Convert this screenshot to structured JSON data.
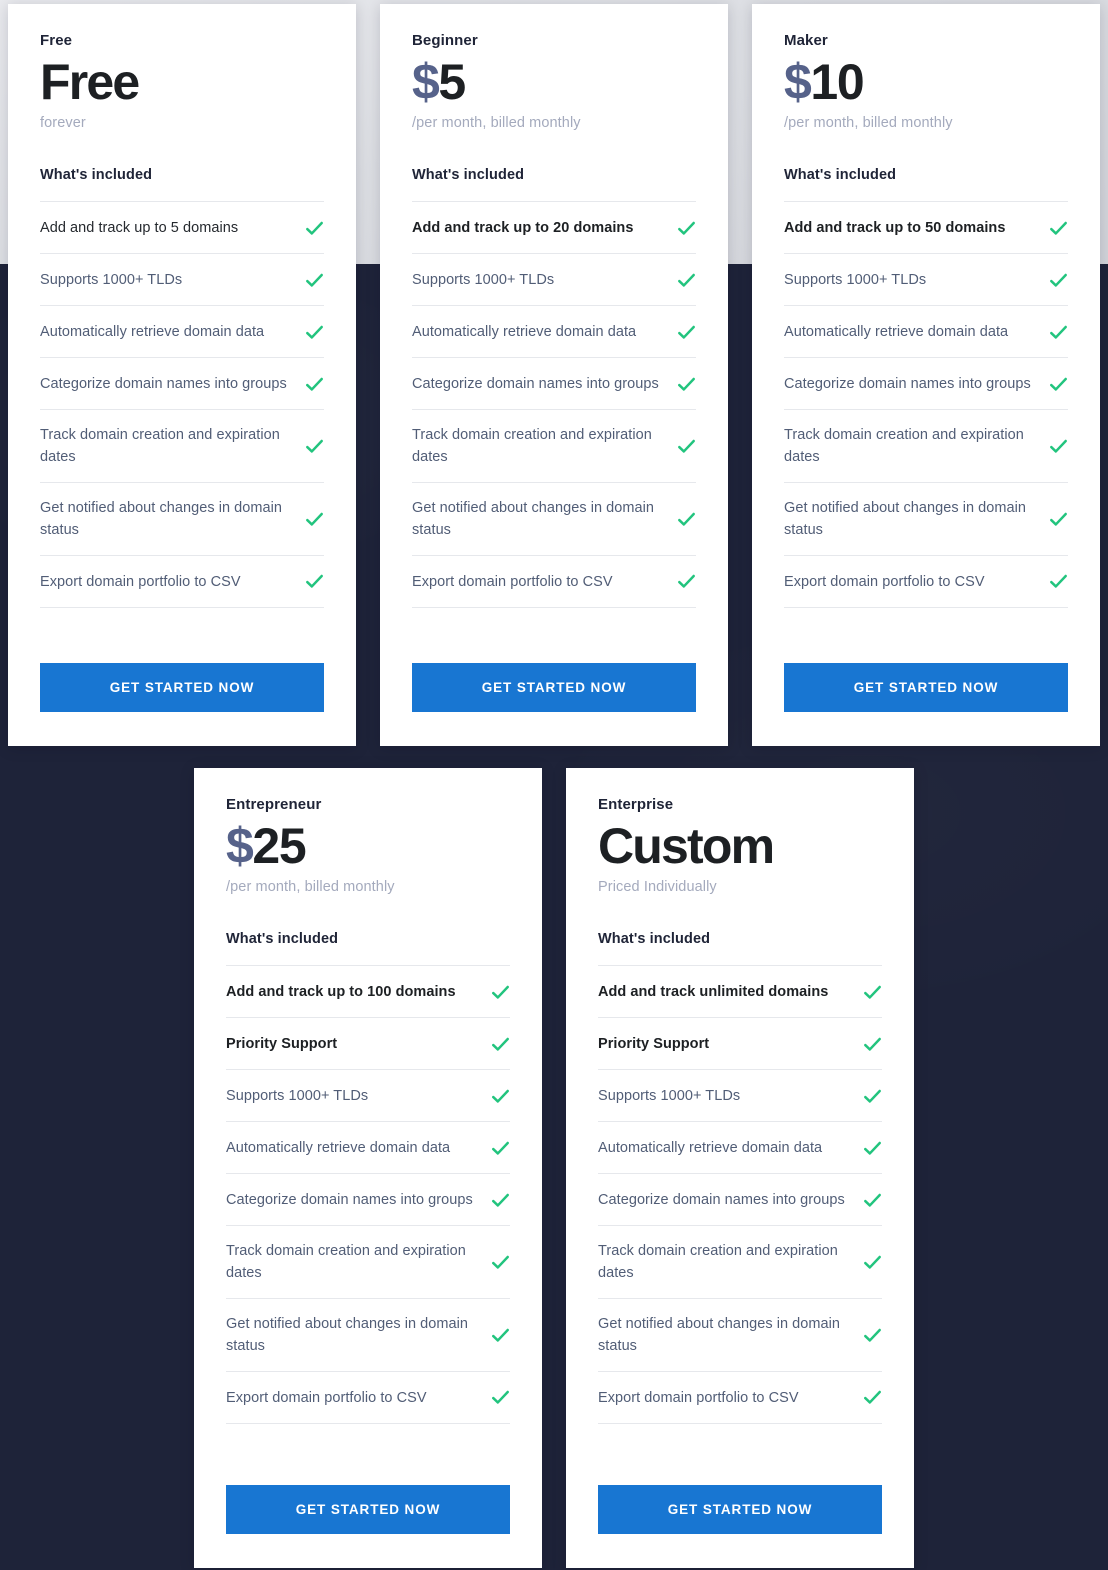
{
  "theme": {
    "page_bg_dark": "#1e2339",
    "page_bg_light": "#e3e5ea",
    "card_bg": "#ffffff",
    "cta_blue": "#1876d2",
    "check_green": "#22c47e",
    "currency_slate": "#56628a",
    "muted_text": "#515d76",
    "note_text": "#a4aabd",
    "heading_text": "#1f2437"
  },
  "labels": {
    "included": "What's included",
    "cta": "GET STARTED NOW"
  },
  "icons": {
    "check": "check-icon"
  },
  "plans": [
    {
      "id": "free",
      "name": "Free",
      "price_currency": "",
      "price_amount": "Free",
      "price_is_word": true,
      "note": "forever",
      "features": [
        {
          "text": "Add and track up to 5 domains",
          "emphasis": "plain",
          "included": true
        },
        {
          "text": "Supports 1000+ TLDs",
          "emphasis": "none",
          "included": true
        },
        {
          "text": "Automatically retrieve domain data",
          "emphasis": "none",
          "included": true
        },
        {
          "text": "Categorize domain names into groups",
          "emphasis": "none",
          "included": true
        },
        {
          "text": "Track domain creation and expiration dates",
          "emphasis": "none",
          "included": true
        },
        {
          "text": "Get notified about changes in domain status",
          "emphasis": "none",
          "included": true
        },
        {
          "text": "Export domain portfolio to CSV",
          "emphasis": "none",
          "included": true
        }
      ]
    },
    {
      "id": "beginner",
      "name": "Beginner",
      "price_currency": "$",
      "price_amount": "5",
      "price_is_word": false,
      "note": "/per month, billed monthly",
      "features": [
        {
          "text": "Add and track up to 20 domains",
          "emphasis": "bold",
          "included": true
        },
        {
          "text": "Supports 1000+ TLDs",
          "emphasis": "none",
          "included": true
        },
        {
          "text": "Automatically retrieve domain data",
          "emphasis": "none",
          "included": true
        },
        {
          "text": "Categorize domain names into groups",
          "emphasis": "none",
          "included": true
        },
        {
          "text": "Track domain creation and expiration dates",
          "emphasis": "none",
          "included": true
        },
        {
          "text": "Get notified about changes in domain status",
          "emphasis": "none",
          "included": true
        },
        {
          "text": "Export domain portfolio to CSV",
          "emphasis": "none",
          "included": true
        }
      ]
    },
    {
      "id": "maker",
      "name": "Maker",
      "price_currency": "$",
      "price_amount": "10",
      "price_is_word": false,
      "note": "/per month, billed monthly",
      "features": [
        {
          "text": "Add and track up to 50 domains",
          "emphasis": "bold",
          "included": true
        },
        {
          "text": "Supports 1000+ TLDs",
          "emphasis": "none",
          "included": true
        },
        {
          "text": "Automatically retrieve domain data",
          "emphasis": "none",
          "included": true
        },
        {
          "text": "Categorize domain names into groups",
          "emphasis": "none",
          "included": true
        },
        {
          "text": "Track domain creation and expiration dates",
          "emphasis": "none",
          "included": true
        },
        {
          "text": "Get notified about changes in domain status",
          "emphasis": "none",
          "included": true
        },
        {
          "text": "Export domain portfolio to CSV",
          "emphasis": "none",
          "included": true
        }
      ]
    },
    {
      "id": "entrepreneur",
      "name": "Entrepreneur",
      "price_currency": "$",
      "price_amount": "25",
      "price_is_word": false,
      "note": "/per month, billed monthly",
      "features": [
        {
          "text": "Add and track up to 100 domains",
          "emphasis": "bold",
          "included": true
        },
        {
          "text": "Priority Support",
          "emphasis": "bold",
          "included": true
        },
        {
          "text": "Supports 1000+ TLDs",
          "emphasis": "none",
          "included": true
        },
        {
          "text": "Automatically retrieve domain data",
          "emphasis": "none",
          "included": true
        },
        {
          "text": "Categorize domain names into groups",
          "emphasis": "none",
          "included": true
        },
        {
          "text": "Track domain creation and expiration dates",
          "emphasis": "none",
          "included": true
        },
        {
          "text": "Get notified about changes in domain status",
          "emphasis": "none",
          "included": true
        },
        {
          "text": "Export domain portfolio to CSV",
          "emphasis": "none",
          "included": true
        }
      ]
    },
    {
      "id": "enterprise",
      "name": "Enterprise",
      "price_currency": "",
      "price_amount": "Custom",
      "price_is_word": true,
      "note": "Priced Individually",
      "features": [
        {
          "text": "Add and track unlimited domains",
          "emphasis": "bold",
          "included": true
        },
        {
          "text": "Priority Support",
          "emphasis": "bold",
          "included": true
        },
        {
          "text": "Supports 1000+ TLDs",
          "emphasis": "none",
          "included": true
        },
        {
          "text": "Automatically retrieve domain data",
          "emphasis": "none",
          "included": true
        },
        {
          "text": "Categorize domain names into groups",
          "emphasis": "none",
          "included": true
        },
        {
          "text": "Track domain creation and expiration dates",
          "emphasis": "none",
          "included": true
        },
        {
          "text": "Get notified about changes in domain status",
          "emphasis": "none",
          "included": true
        },
        {
          "text": "Export domain portfolio to CSV",
          "emphasis": "none",
          "included": true
        }
      ]
    }
  ]
}
